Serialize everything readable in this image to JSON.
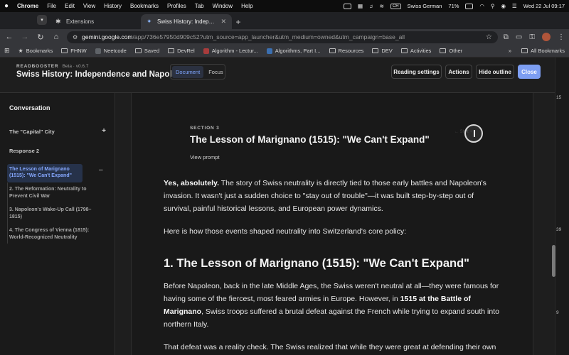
{
  "menubar": {
    "app": "Chrome",
    "items": [
      "File",
      "Edit",
      "View",
      "History",
      "Bookmarks",
      "Profiles",
      "Tab",
      "Window",
      "Help"
    ],
    "language": "Swiss German",
    "battery": "71%",
    "datetime": "Wed 22 Jul  09:17"
  },
  "tabs": [
    {
      "title": "Extensions",
      "active": false
    },
    {
      "title": "Swiss History: Independence",
      "active": true
    }
  ],
  "toolbar": {
    "url_host": "gemini.google.com",
    "url_path": "/app/736e57950d909c52?utm_source=app_launcher&utm_medium=owned&utm_campaign=base_all"
  },
  "bookmarks": {
    "items": [
      "Bookmarks",
      "FHNW",
      "Neetcode",
      "Saved",
      "DevRel",
      "Algorithm - Lectur...",
      "Algorithms, Part I...",
      "Resources",
      "DEV",
      "Activities",
      "Other"
    ],
    "overflow": "»",
    "all": "All Bookmarks"
  },
  "header": {
    "brand": "READBOOSTER",
    "version": "Beta · v0.6.7",
    "title": "Swiss History: Independence and Napoleon",
    "view_document": "Document",
    "view_focus": "Focus",
    "btn_reading_settings": "Reading settings",
    "btn_actions": "Actions",
    "btn_hide_outline": "Hide outline",
    "btn_close": "Close"
  },
  "sidebar": {
    "title": "Conversation",
    "items": [
      {
        "label": "The \"Capital\" City",
        "toggle": "+"
      },
      {
        "label": "Response 2",
        "toggle": ""
      }
    ],
    "active_item": "The Lesson of Marignano (1515): \"We Can't Expand\"",
    "active_toggle": "–",
    "subitems": [
      "2. The Reformation: Neutrality to Prevent Civil War",
      "3. Napoleon's Wake-Up Call (1798–1815)",
      "4. The Congress of Vienna (1815): World-Recognized Neutrality"
    ]
  },
  "reader": {
    "section_label": "SECTION 3",
    "section_title": "The Lesson of Marignano (1515): \"We Can't Expand\"",
    "view_prompt": "View prompt",
    "faint_hint": "← Shift + ",
    "p1_bold": "Yes, absolutely.",
    "p1_rest": " The story of Swiss neutrality is directly tied to those early battles and Napoleon's invasion. It wasn't just a sudden choice to \"stay out of trouble\"—it was built step-by-step out of survival, painful historical lessons, and European power dynamics.",
    "p2": "Here is how those events shaped neutrality into Switzerland's core policy:",
    "h1": "1. The Lesson of Marignano (1515): \"We Can't Expand\"",
    "p3_a": "Before Napoleon, back in the late Middle Ages, the Swiss weren't neutral at all—they were famous for having some of the fiercest, most feared armies in Europe. However, in ",
    "p3_bold": "1515 at the Battle of Marignano",
    "p3_b": ", Swiss troops suffered a brutal defeat against the French while trying to expand south into northern Italy.",
    "p4": "That defeat was a reality check. The Swiss realized that while they were great at defending their own"
  },
  "edge": {
    "n1": "15",
    "n2": "39",
    "n3": "9"
  }
}
